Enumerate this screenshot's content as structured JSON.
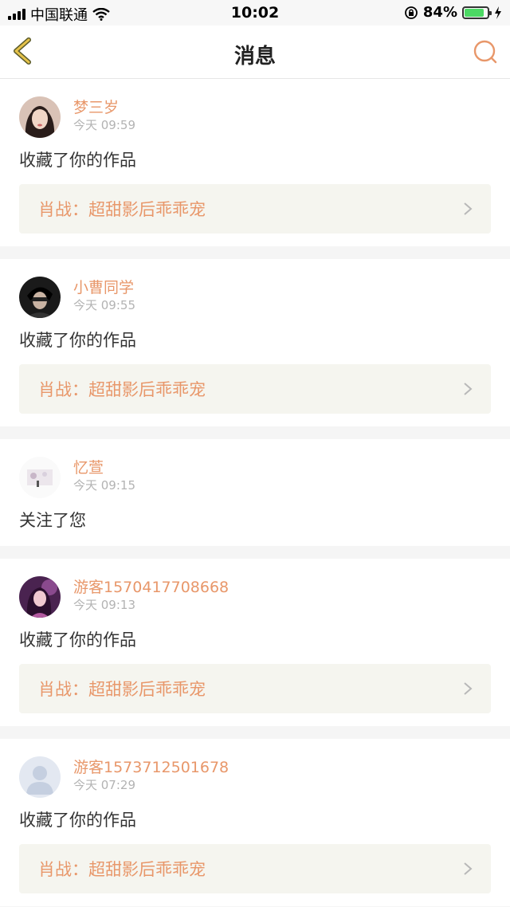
{
  "status_bar": {
    "carrier": "中国联通",
    "time": "10:02",
    "battery_percent": "84%",
    "battery_level": 0.84
  },
  "nav": {
    "title": "消息",
    "back_icon": "back-chevron-icon",
    "search_icon": "search-icon"
  },
  "colors": {
    "accent": "#e8976a",
    "back_icon": "#e5c24a"
  },
  "messages": [
    {
      "name": "梦三岁",
      "time": "今天 09:59",
      "action": "收藏了你的作品",
      "work": "肖战：超甜影后乖乖宠",
      "avatar": "girl-photo-avatar"
    },
    {
      "name": "小曹同学",
      "time": "今天 09:55",
      "action": "收藏了你的作品",
      "work": "肖战：超甜影后乖乖宠",
      "avatar": "dark-photo-avatar"
    },
    {
      "name": "忆萱",
      "time": "今天 09:15",
      "action": "关注了您",
      "avatar": "light-photo-avatar"
    },
    {
      "name": "游客1570417708668",
      "time": "今天 09:13",
      "action": "收藏了你的作品",
      "work": "肖战：超甜影后乖乖宠",
      "avatar": "purple-photo-avatar"
    },
    {
      "name": "游客1573712501678",
      "time": "今天 07:29",
      "action": "收藏了你的作品",
      "work": "肖战：超甜影后乖乖宠",
      "avatar": "default-user-avatar"
    }
  ]
}
